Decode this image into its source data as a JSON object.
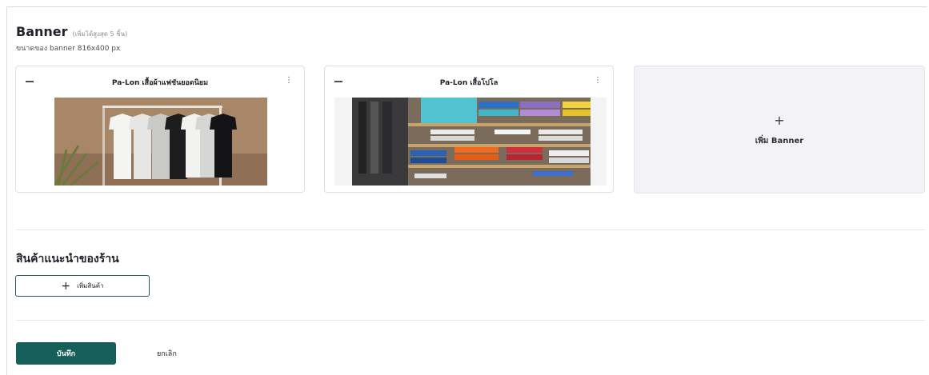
{
  "banner_section": {
    "title": "Banner",
    "limit_note": "(เพิ่มได้สูงสุด 5 ชิ้น)",
    "size_note": "ขนาดของ banner 816x400 px",
    "banners": [
      {
        "name": "Pa-Lon เสื้อผ้าแฟชันยอดนิยม",
        "image": "white and black t-shirts on hanger rack"
      },
      {
        "name": "Pa-Lon เสื้อโปโล",
        "image": "folded colorful shirts on store shelves"
      }
    ],
    "add_banner_label": "เพิ่ม Banner",
    "add_icon": "plus-icon",
    "menu_icon": "kebab-menu-icon",
    "drag_icon": "drag-handle-icon"
  },
  "recommend_section": {
    "title": "สินค้าแนะนำของร้าน",
    "add_product_label": "เพิ่มสินค้า"
  },
  "actions": {
    "save_label": "บันทึก",
    "cancel_label": "ยกเลิก"
  },
  "colors": {
    "primary": "#155e5a",
    "add_banner_bg": "#f2f2f7"
  }
}
